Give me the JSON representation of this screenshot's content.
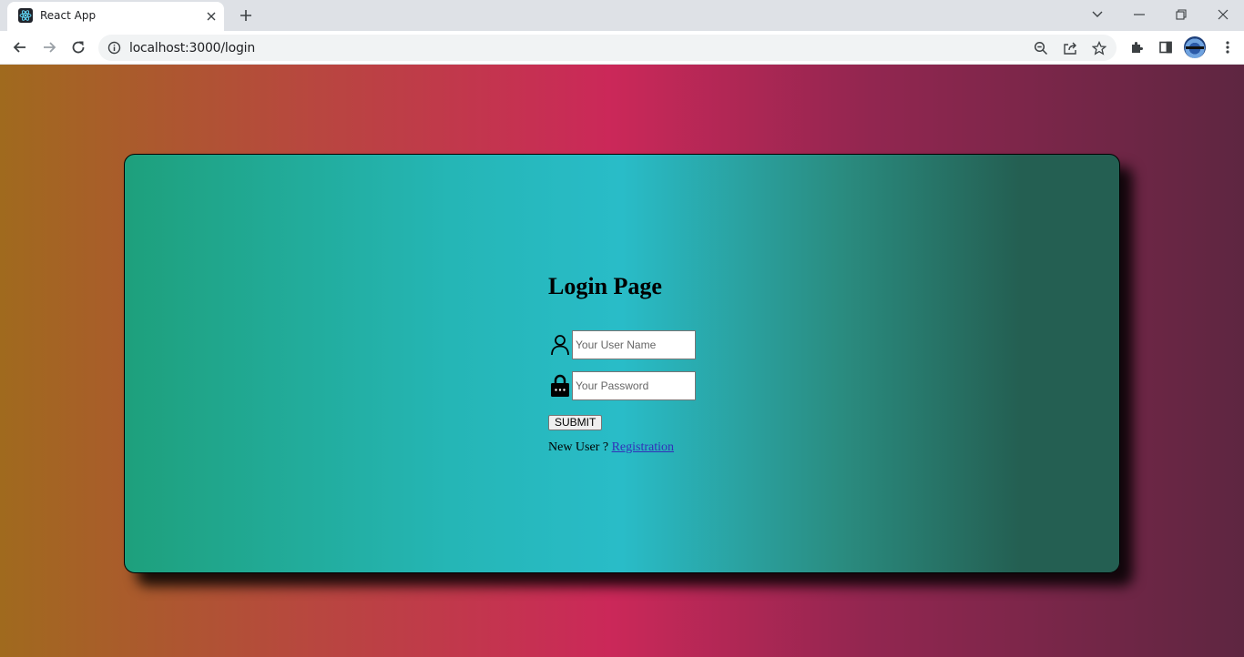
{
  "browser": {
    "tab_title": "React App",
    "url": "localhost:3000/login"
  },
  "login": {
    "title": "Login Page",
    "username_placeholder": "Your User Name",
    "password_placeholder": "Your Password",
    "submit_label": "SUBMIT",
    "new_user_text": "New User ?",
    "registration_link": "Registration"
  },
  "icons": {
    "favicon": "react-icon",
    "user": "user-icon",
    "password": "lock-icon"
  },
  "colors": {
    "page_gradient": [
      "#a06a1e",
      "#cb2859",
      "#5e2641"
    ],
    "card_gradient": [
      "#1ea07c",
      "#29bcc8",
      "#245f52"
    ]
  }
}
